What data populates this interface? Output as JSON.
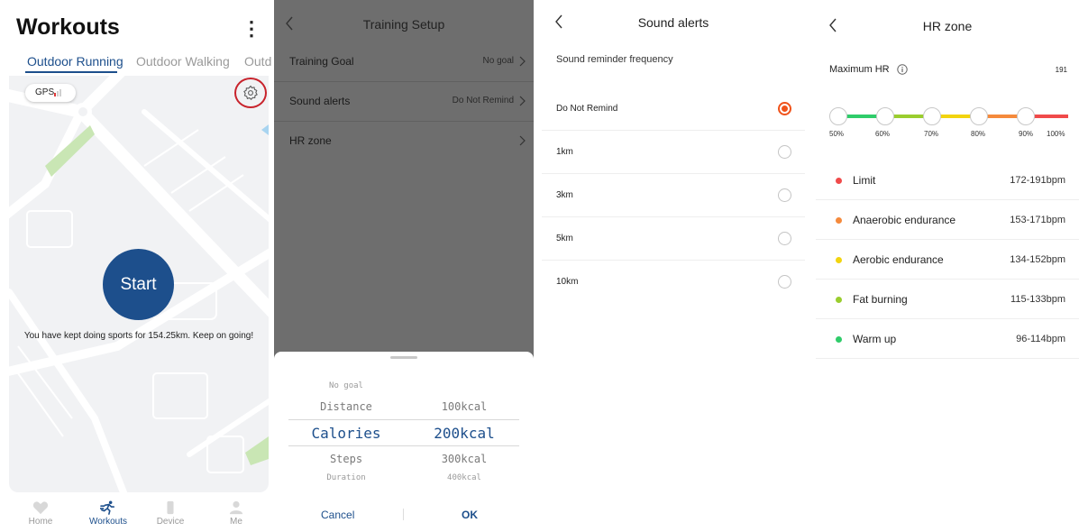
{
  "workouts": {
    "title": "Workouts",
    "menu_glyph": "⋮",
    "tabs": [
      {
        "label": "Outdoor Running",
        "active": true
      },
      {
        "label": "Outdoor Walking",
        "active": false
      },
      {
        "label": "Outd",
        "active": false
      }
    ],
    "gps_label": "GPS",
    "start_label": "Start",
    "message": "You have kept doing sports for 154.25km. Keep on going!",
    "nav": [
      {
        "label": "Home",
        "icon": "heart-icon",
        "active": false
      },
      {
        "label": "Workouts",
        "icon": "running-icon",
        "active": true
      },
      {
        "label": "Device",
        "icon": "watch-icon",
        "active": false
      },
      {
        "label": "Me",
        "icon": "person-icon",
        "active": false
      }
    ],
    "colors": {
      "accent": "#1d4f8c",
      "highlight_ring": "#c8232c",
      "park": "#c9e6b4"
    }
  },
  "training_setup": {
    "title": "Training Setup",
    "rows": [
      {
        "label": "Training Goal",
        "value": "No goal"
      },
      {
        "label": "Sound alerts",
        "value": "Do Not Remind"
      },
      {
        "label": "HR zone",
        "value": ""
      }
    ],
    "picker_left": [
      "No goal",
      "Distance",
      "Calories",
      "Steps",
      "Duration"
    ],
    "picker_right": [
      "100kcal",
      "200kcal",
      "300kcal",
      "400kcal"
    ],
    "picker_selected_left": "Calories",
    "picker_selected_right": "200kcal",
    "cancel_label": "Cancel",
    "ok_label": "OK"
  },
  "sound_alerts": {
    "title": "Sound alerts",
    "subtitle": "Sound reminder frequency",
    "options": [
      {
        "label": "Do Not Remind",
        "selected": true
      },
      {
        "label": "1km",
        "selected": false
      },
      {
        "label": "3km",
        "selected": false
      },
      {
        "label": "5km",
        "selected": false
      },
      {
        "label": "10km",
        "selected": false
      }
    ],
    "radio_color": "#f0521a"
  },
  "hr_zone": {
    "title": "HR zone",
    "max_hr_label": "Maximum HR",
    "max_hr_value": "191",
    "percents": [
      "50%",
      "60%",
      "70%",
      "80%",
      "90%",
      "100%"
    ],
    "zones": [
      {
        "name": "Limit",
        "range": "172-191bpm",
        "color": "#f04a4a"
      },
      {
        "name": "Anaerobic endurance",
        "range": "153-171bpm",
        "color": "#f58a3c"
      },
      {
        "name": "Aerobic endurance",
        "range": "134-152bpm",
        "color": "#f2d40f"
      },
      {
        "name": "Fat burning",
        "range": "115-133bpm",
        "color": "#9acd2e"
      },
      {
        "name": "Warm up",
        "range": "96-114bpm",
        "color": "#2fcc6a"
      }
    ],
    "bar_colors": [
      "#2fcc6a",
      "#9acd2e",
      "#f2d40f",
      "#f58a3c",
      "#f04a4a"
    ]
  }
}
